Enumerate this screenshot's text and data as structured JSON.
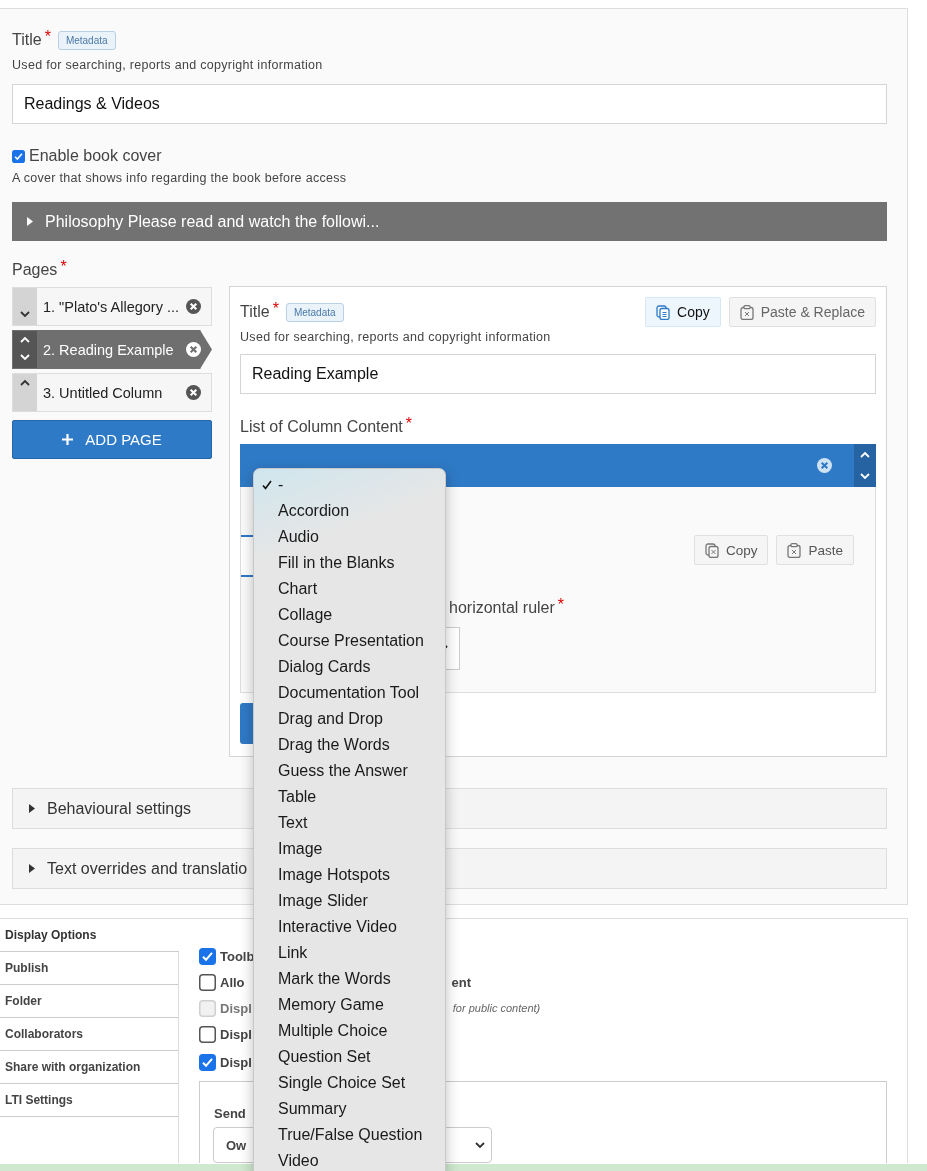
{
  "title_field": {
    "label": "Title",
    "required_mark": "*",
    "tag": "Metadata",
    "description": "Used for searching, reports and copyright information",
    "value": "Readings & Videos"
  },
  "book_cover": {
    "label": "Enable book cover",
    "checked": true,
    "description": "A cover that shows info regarding the book before access"
  },
  "section_header": {
    "label": "Philosophy Please read and watch the followi..."
  },
  "pages": {
    "label": "Pages",
    "required_mark": "*",
    "add_button": "ADD PAGE",
    "items": [
      {
        "label": "1. \"Plato's Allegory ...",
        "selected": false
      },
      {
        "label": "2. Reading Example",
        "selected": true
      },
      {
        "label": "3. Untitled Column",
        "selected": false
      }
    ]
  },
  "page_editor": {
    "title_label": "Title",
    "required_mark": "*",
    "tag": "Metadata",
    "copy_button": "Copy",
    "paste_button": "Paste & Replace",
    "description": "Used for searching, reports and copyright information",
    "value": "Reading Example",
    "list_label": "List of Column Content",
    "list_required_mark": "*",
    "item": {
      "copy_button": "Copy",
      "paste_button": "Paste",
      "ruler_label": "horizontal ruler",
      "ruler_required_mark": "*"
    }
  },
  "collapsibles": [
    {
      "label": "Behavioural settings"
    },
    {
      "label": "Text overrides and translatio"
    }
  ],
  "settings_tabs": [
    {
      "label": "Display Options",
      "selected": true
    },
    {
      "label": "Publish",
      "selected": false
    },
    {
      "label": "Folder",
      "selected": false
    },
    {
      "label": "Collaborators",
      "selected": false
    },
    {
      "label": "Share with organization",
      "selected": false
    },
    {
      "label": "LTI Settings",
      "selected": false
    }
  ],
  "options": [
    {
      "label": "Toolb",
      "checked": true,
      "disabled": false
    },
    {
      "label": "Allo",
      "checked": false,
      "disabled": false,
      "trailing": "ent"
    },
    {
      "label": "Displ",
      "checked": false,
      "disabled": true,
      "note": "for public content)"
    },
    {
      "label": "Displ",
      "checked": false,
      "disabled": false
    },
    {
      "label": "Displ",
      "checked": true,
      "disabled": false
    }
  ],
  "send": {
    "label": "Send",
    "value": "Ow"
  },
  "dropdown": {
    "options": [
      {
        "label": "-",
        "selected": true
      },
      {
        "label": "Accordion",
        "selected": false
      },
      {
        "label": "Audio",
        "selected": false
      },
      {
        "label": "Fill in the Blanks",
        "selected": false
      },
      {
        "label": "Chart",
        "selected": false
      },
      {
        "label": "Collage",
        "selected": false
      },
      {
        "label": "Course Presentation",
        "selected": false
      },
      {
        "label": "Dialog Cards",
        "selected": false
      },
      {
        "label": "Documentation Tool",
        "selected": false
      },
      {
        "label": "Drag and Drop",
        "selected": false
      },
      {
        "label": "Drag the Words",
        "selected": false
      },
      {
        "label": "Guess the Answer",
        "selected": false
      },
      {
        "label": "Table",
        "selected": false
      },
      {
        "label": "Text",
        "selected": false
      },
      {
        "label": "Image",
        "selected": false
      },
      {
        "label": "Image Hotspots",
        "selected": false
      },
      {
        "label": "Image Slider",
        "selected": false
      },
      {
        "label": "Interactive Video",
        "selected": false
      },
      {
        "label": "Link",
        "selected": false
      },
      {
        "label": "Mark the Words",
        "selected": false
      },
      {
        "label": "Memory Game",
        "selected": false
      },
      {
        "label": "Multiple Choice",
        "selected": false
      },
      {
        "label": "Question Set",
        "selected": false
      },
      {
        "label": "Single Choice Set",
        "selected": false
      },
      {
        "label": "Summary",
        "selected": false
      },
      {
        "label": "True/False Question",
        "selected": false
      },
      {
        "label": "Video",
        "selected": false
      }
    ]
  }
}
